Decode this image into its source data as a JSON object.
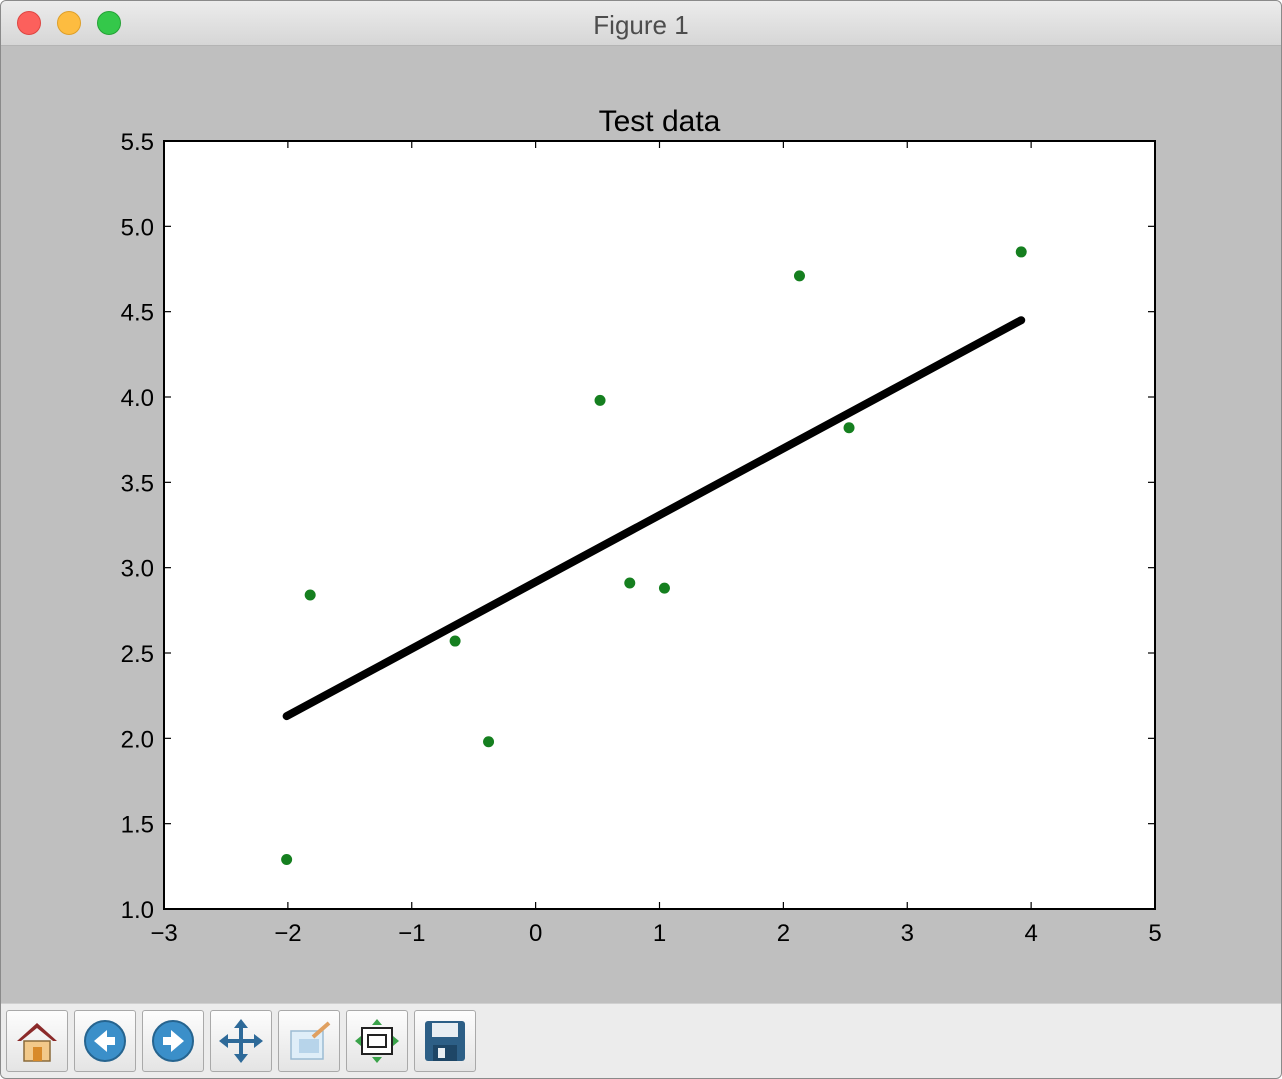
{
  "window": {
    "title": "Figure 1"
  },
  "toolbar": {
    "buttons": [
      {
        "name": "home-icon"
      },
      {
        "name": "back-icon"
      },
      {
        "name": "forward-icon"
      },
      {
        "name": "pan-icon"
      },
      {
        "name": "zoom-icon"
      },
      {
        "name": "subplots-icon"
      },
      {
        "name": "save-icon"
      }
    ]
  },
  "colors": {
    "points": "#157f1f",
    "line": "#000000",
    "plot_bg": "#ffffff",
    "figure_bg": "#bfbfbf"
  },
  "chart_data": {
    "type": "scatter",
    "title": "Test data",
    "xlabel": "",
    "ylabel": "",
    "xlim": [
      -3,
      5
    ],
    "ylim": [
      1.0,
      5.5
    ],
    "xticks": [
      "−3",
      "−2",
      "−1",
      "0",
      "1",
      "2",
      "3",
      "4",
      "5"
    ],
    "yticks": [
      "1.0",
      "1.5",
      "2.0",
      "2.5",
      "3.0",
      "3.5",
      "4.0",
      "4.5",
      "5.0",
      "5.5"
    ],
    "grid": false,
    "series": [
      {
        "kind": "scatter",
        "color": "#157f1f",
        "points": [
          {
            "x": -2.01,
            "y": 1.29
          },
          {
            "x": -1.82,
            "y": 2.84
          },
          {
            "x": -0.65,
            "y": 2.57
          },
          {
            "x": -0.38,
            "y": 1.98
          },
          {
            "x": 0.52,
            "y": 3.98
          },
          {
            "x": 0.76,
            "y": 2.91
          },
          {
            "x": 1.04,
            "y": 2.88
          },
          {
            "x": 2.13,
            "y": 4.71
          },
          {
            "x": 2.53,
            "y": 3.82
          },
          {
            "x": 3.92,
            "y": 4.85
          }
        ]
      },
      {
        "kind": "line",
        "color": "#000000",
        "points": [
          {
            "x": -2.01,
            "y": 2.13
          },
          {
            "x": 3.92,
            "y": 4.45
          }
        ]
      }
    ]
  }
}
